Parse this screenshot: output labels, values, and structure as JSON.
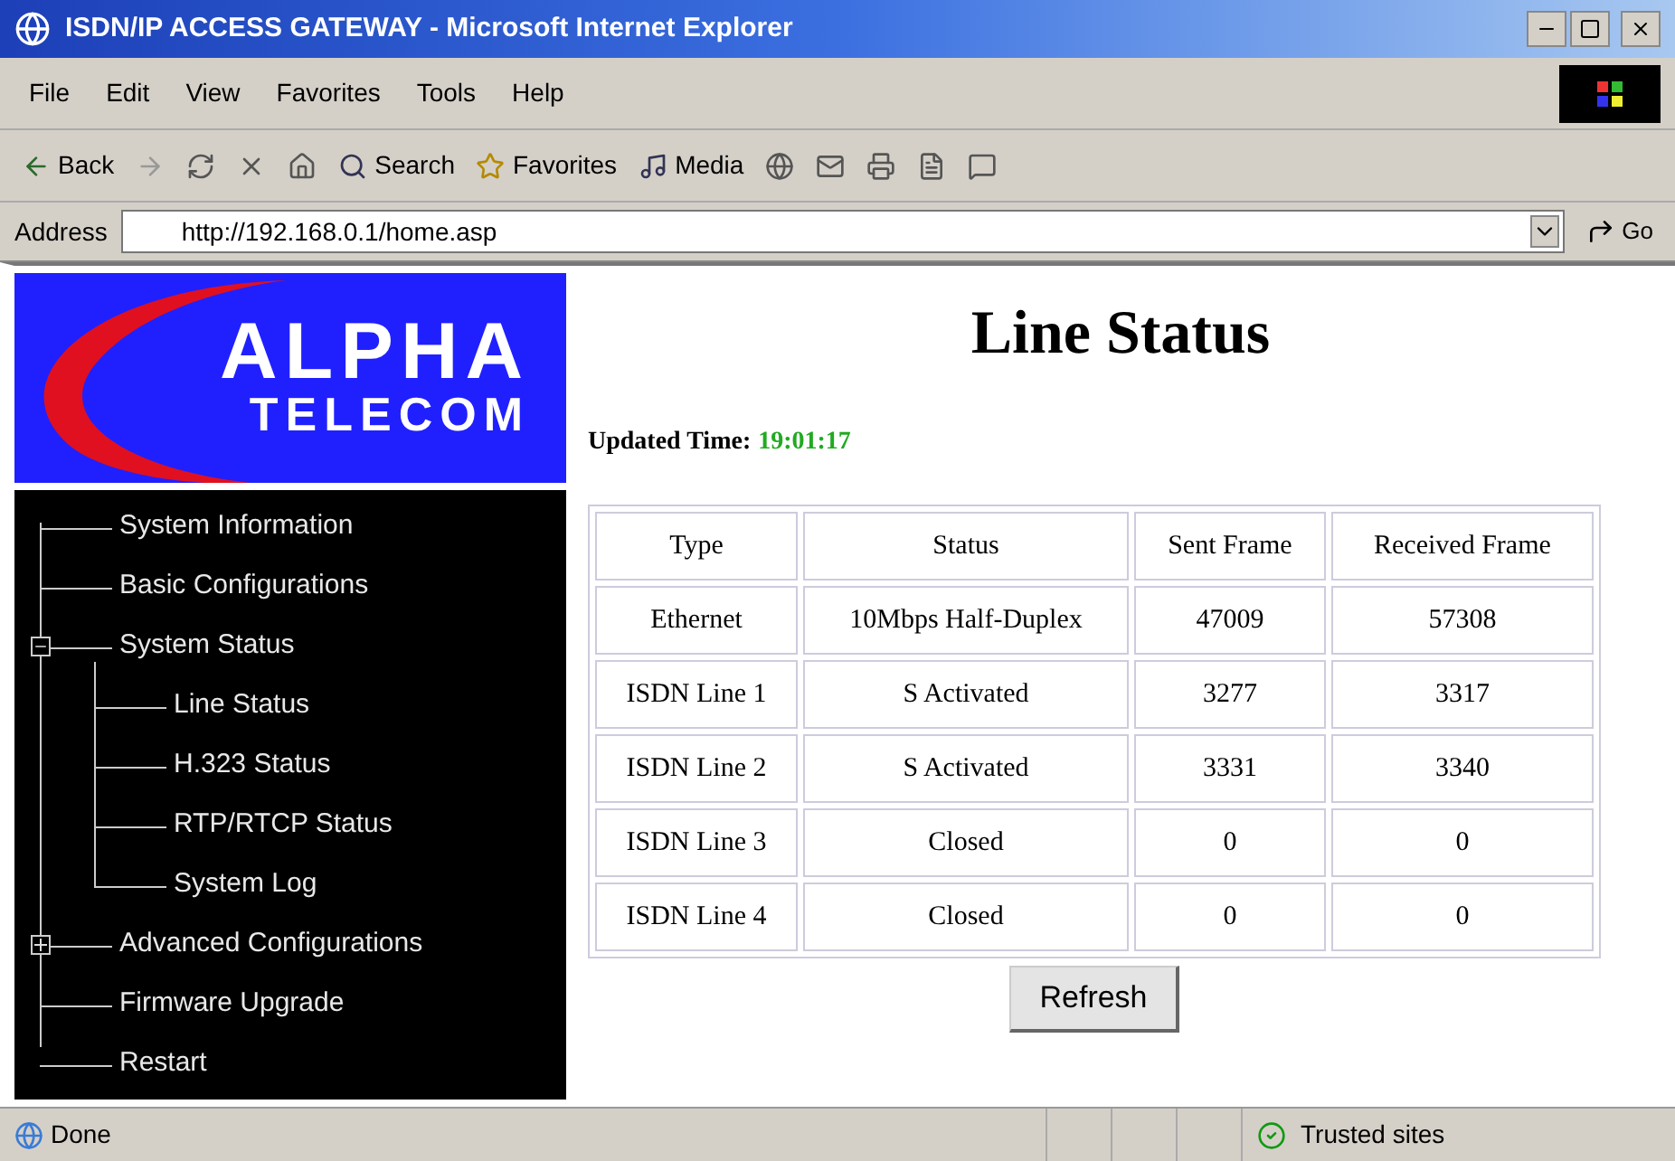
{
  "window": {
    "title": "ISDN/IP ACCESS GATEWAY - Microsoft Internet Explorer"
  },
  "menu": [
    "File",
    "Edit",
    "View",
    "Favorites",
    "Tools",
    "Help"
  ],
  "toolbar": [
    {
      "kind": "back",
      "label": "Back"
    },
    {
      "kind": "search",
      "label": "Search"
    },
    {
      "kind": "favorites",
      "label": "Favorites"
    },
    {
      "kind": "media",
      "label": "Media"
    }
  ],
  "address": {
    "label": "Address",
    "value": "http://192.168.0.1/home.asp",
    "go": "Go"
  },
  "logo": {
    "line_1": "ALPHA",
    "line_2": "TELECOM"
  },
  "sidebar": {
    "items": [
      {
        "label": "System Information"
      },
      {
        "label": "Basic Configurations"
      },
      {
        "label": "System Status",
        "expanded": true,
        "children": [
          {
            "label": "Line Status"
          },
          {
            "label": "H.323 Status"
          },
          {
            "label": "RTP/RTCP Status"
          },
          {
            "label": "System Log"
          }
        ]
      },
      {
        "label": "Advanced Configurations",
        "expanded": false
      },
      {
        "label": "Firmware Upgrade"
      },
      {
        "label": "Restart"
      }
    ]
  },
  "page": {
    "title": "Line Status",
    "updated_label": "Updated Time:",
    "updated_value": "19:01:17"
  },
  "table": {
    "columns": [
      "Type",
      "Status",
      "Sent Frame",
      "Received Frame"
    ],
    "rows": [
      [
        "Ethernet",
        "10Mbps Half-Duplex",
        "47009",
        "57308"
      ],
      [
        "ISDN Line 1",
        "S Activated",
        "3277",
        "3317"
      ],
      [
        "ISDN Line 2",
        "S Activated",
        "3331",
        "3340"
      ],
      [
        "ISDN Line 3",
        "Closed",
        "0",
        "0"
      ],
      [
        "ISDN Line 4",
        "Closed",
        "0",
        "0"
      ]
    ]
  },
  "refresh_button": "Refresh",
  "status_bar": {
    "text": "Done",
    "zone": "Trusted sites"
  }
}
